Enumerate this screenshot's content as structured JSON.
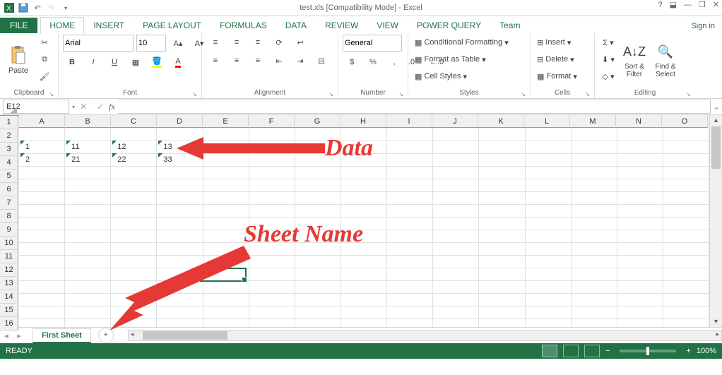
{
  "window": {
    "title": "test.xls  [Compatibility Mode] - Excel",
    "help": "?",
    "signin": "Sign in"
  },
  "tabs": {
    "file": "FILE",
    "items": [
      "HOME",
      "INSERT",
      "PAGE LAYOUT",
      "FORMULAS",
      "DATA",
      "REVIEW",
      "VIEW",
      "POWER QUERY",
      "Team"
    ],
    "active": 0
  },
  "ribbon": {
    "clipboard": {
      "label": "Clipboard",
      "paste": "Paste"
    },
    "font": {
      "label": "Font",
      "name": "Arial",
      "size": "10",
      "bold": "B",
      "italic": "I",
      "underline": "U"
    },
    "alignment": {
      "label": "Alignment",
      "wrap": "Wrap Text",
      "merge": "Merge & Center"
    },
    "number": {
      "label": "Number",
      "format": "General"
    },
    "styles": {
      "label": "Styles",
      "cond": "Conditional Formatting",
      "table": "Format as Table",
      "cell": "Cell Styles"
    },
    "cells": {
      "label": "Cells",
      "insert": "Insert",
      "delete": "Delete",
      "format": "Format"
    },
    "editing": {
      "label": "Editing",
      "sort": "Sort & Filter",
      "find": "Find & Select"
    }
  },
  "namebox": "E12",
  "columns": [
    "A",
    "B",
    "C",
    "D",
    "E",
    "F",
    "G",
    "H",
    "I",
    "J",
    "K",
    "L",
    "M",
    "N",
    "O"
  ],
  "rows": [
    1,
    2,
    3,
    4,
    5,
    6,
    7,
    8,
    9,
    10,
    11,
    12,
    13,
    14,
    15,
    16
  ],
  "sheetdata": {
    "r2": {
      "A": "1",
      "B": "11",
      "C": "12",
      "D": "13"
    },
    "r3": {
      "A": "2",
      "B": "21",
      "C": "22",
      "D": "33"
    }
  },
  "active_cell": {
    "col": 4,
    "row": 11
  },
  "sheet": {
    "name": "First Sheet",
    "new": "+"
  },
  "status": {
    "ready": "READY",
    "zoom": "100%"
  },
  "annotations": {
    "data": "Data",
    "sheetname": "Sheet Name"
  },
  "chart_data": {
    "type": "table",
    "columns": [
      "A",
      "B",
      "C",
      "D"
    ],
    "rows": [
      [
        1,
        11,
        12,
        13
      ],
      [
        2,
        21,
        22,
        33
      ]
    ]
  }
}
